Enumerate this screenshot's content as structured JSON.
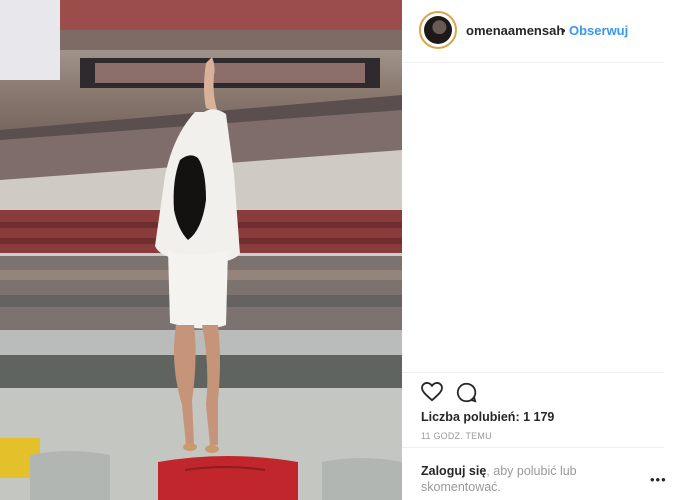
{
  "post": {
    "username": "omenaamensah",
    "separator": "•",
    "follow_label": "Obserwuj",
    "likes_label": "Liczba polubień:",
    "likes_count": "1 179",
    "timestamp": "11 GODZ. TEMU",
    "login_link": "Zaloguj się",
    "login_rest": ", aby polubić lub skomentować.",
    "more_label": "•••",
    "photo_description": "",
    "icons": {
      "like": "heart-icon",
      "comment": "comment-icon",
      "more": "more-options-icon"
    },
    "colors": {
      "link": "#3897f0",
      "text": "#262626",
      "muted": "#999999",
      "seat_red": "#c0262b"
    }
  }
}
